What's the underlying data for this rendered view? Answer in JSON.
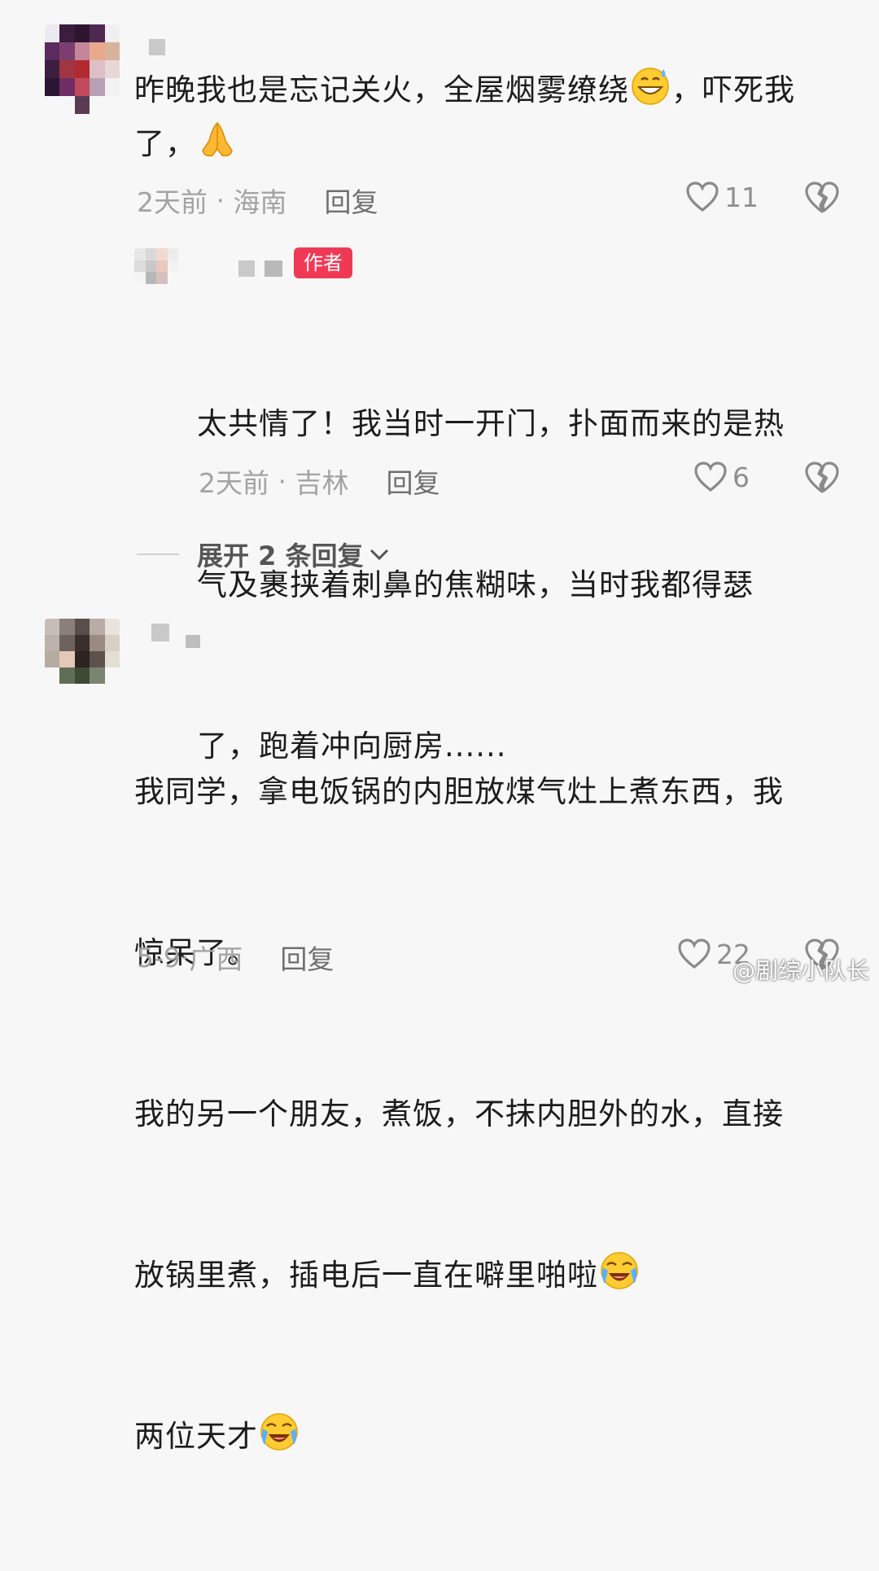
{
  "comments": [
    {
      "text_line1": "昨晚我也是忘记关火，全屋烟雾缭绕",
      "text_line1_end": "，吓死我",
      "text_line2": "了，",
      "emoji_1": "grinning-sweat-emoji",
      "emoji_2": "folded-hands-emoji",
      "time": "2天前",
      "location": "海南",
      "reply_label": "回复",
      "likes": "11",
      "replies": [
        {
          "author_badge": "作者",
          "text_lines": [
            "太共情了！我当时一开门，扑面而来的是热",
            "气及裹挟着刺鼻的焦糊味，当时我都得瑟",
            "了，跑着冲向厨房......"
          ],
          "time": "2天前",
          "location": "吉林",
          "reply_label": "回复",
          "likes": "6"
        }
      ],
      "expand_label": "展开 2 条回复"
    },
    {
      "text_lines": [
        "我同学，拿电饭锅的内胆放煤气灶上煮东西，我",
        "惊呆了。",
        "我的另一个朋友，煮饭，不抹内胆外的水，直接",
        "放锅里煮，插电后一直在噼里啪啦",
        "两位天才"
      ],
      "emoji": "loudly-crying-emoji",
      "time": "5-9",
      "location": "广西",
      "reply_label": "回复",
      "likes": "22"
    }
  ],
  "icons": {
    "like": "heart-outline-icon",
    "dislike": "broken-heart-icon",
    "expand": "chevron-down-icon"
  },
  "colors": {
    "badge": "#f03a55",
    "meta": "#a3a3a3"
  },
  "watermark": "@剧综小队长"
}
